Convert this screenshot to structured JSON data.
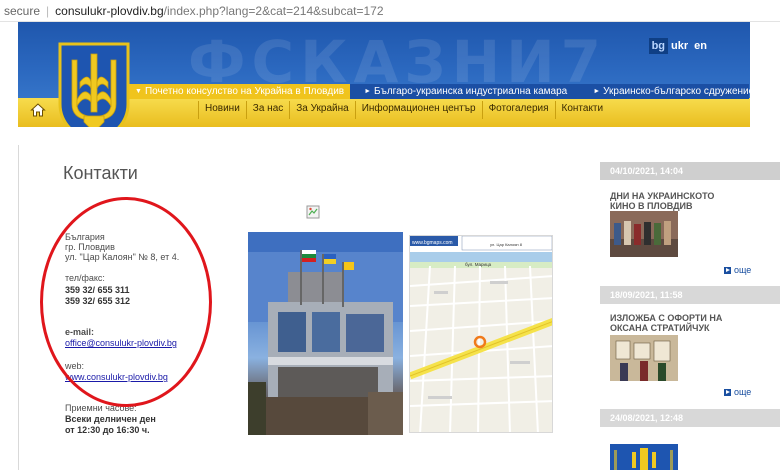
{
  "browser": {
    "security": "secure",
    "host": "consulukr-plovdiv.bg",
    "path": "/index.php?lang=2&cat=214&subcat=172"
  },
  "header": {
    "background_text": "ФСКАЗНИ7",
    "languages": [
      "bg",
      "ukr",
      "en"
    ],
    "active_language": "bg",
    "top_links": [
      "Почетно консулство на Украйна в Пловдив",
      "Българо-украинска индустриална камара",
      "Украинско-българско сдружение Пловдив"
    ],
    "menu": [
      "Новини",
      "За нас",
      "За Украйна",
      "Информационен център",
      "Фотогалерия",
      "Контакти"
    ],
    "home_icon": "home-icon",
    "emblem_icon": "ukraine-trident-emblem"
  },
  "contacts": {
    "title": "Контакти",
    "address": [
      "България",
      "гр. Пловдив",
      "ул. \"Цар Калоян\" № 8, ет 4."
    ],
    "phone_label": "тел/факс:",
    "phones": [
      "359 32/ 655 311",
      "359 32/ 655 312"
    ],
    "email_label": "e-mail:",
    "email": "office@consulukr-plovdiv.bg",
    "web_label": "web:",
    "web": "www.consulukr-plovdiv.bg",
    "hours_label": "Приемни часове:",
    "hours_days": "Всеки делничен ден",
    "hours_time": "от 12:30 до 16:30 ч."
  },
  "map": {
    "header": "www.bgmaps.com",
    "street_top": "бул. Марица",
    "note": "ул. Цар Калоян 8"
  },
  "news": [
    {
      "date": "04/10/2021, 14:04",
      "title": "ДНИ НА УКРАИНСКОТО КИНО В ПЛОВДИВ",
      "more": "още"
    },
    {
      "date": "18/09/2021, 11:58",
      "title": "ИЗЛОЖБА С ОФОРТИ НА ОКСАНА СТРАТИЙЧУК",
      "more": "още"
    },
    {
      "date": "24/08/2021, 12:48",
      "title": "",
      "more": ""
    }
  ],
  "colors": {
    "ukraine_blue": "#1f57ad",
    "ukraine_yellow": "#f2d23a",
    "annotation_red": "#e0161c",
    "link_blue": "#1a1aa8"
  }
}
